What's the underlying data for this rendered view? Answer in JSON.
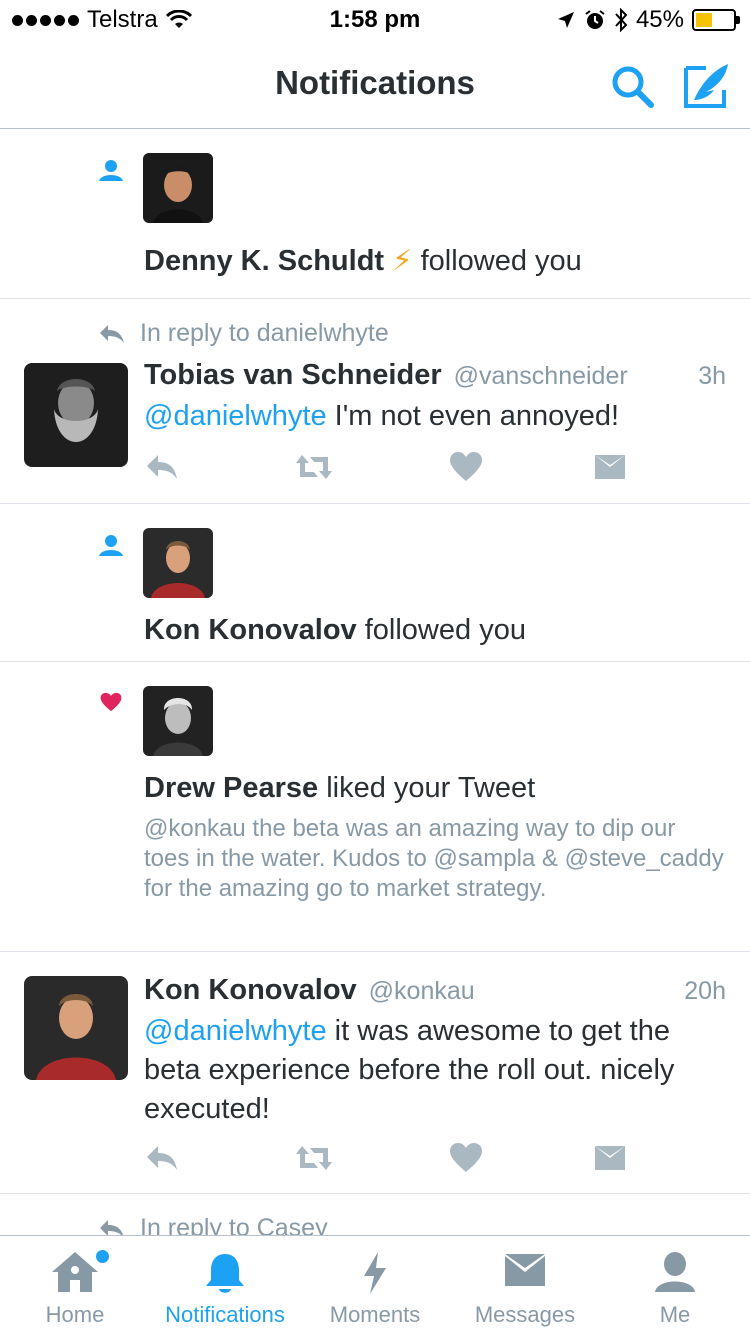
{
  "status_bar": {
    "carrier": "Telstra",
    "time": "1:58 pm",
    "battery_percent": "45%",
    "battery_level": 0.45,
    "signal_bars": 5
  },
  "header": {
    "title": "Notifications",
    "search_icon": "search-icon",
    "compose_icon": "compose-tweet-icon"
  },
  "notifications": [
    {
      "type": "follow",
      "name": "Denny K. Schuldt",
      "name_emoji": "⚡",
      "action": "followed you"
    },
    {
      "type": "reply",
      "reply_context": "In reply to danielwhyte",
      "name": "Tobias van Schneider",
      "handle": "@vanschneider",
      "age": "3h",
      "mention": "@danielwhyte",
      "text": " I'm not even annoyed!"
    },
    {
      "type": "follow",
      "name": "Kon Konovalov",
      "action": "followed you"
    },
    {
      "type": "like",
      "name": "Drew Pearse",
      "action": "liked your Tweet",
      "quoted": "@konkau the beta was an amazing way to dip our toes in the water. Kudos to @sampla & @steve_caddy for the amazing go to market strategy."
    },
    {
      "type": "mention",
      "name": "Kon Konovalov",
      "handle": "@konkau",
      "age": "20h",
      "mention": "@danielwhyte",
      "text": " it was awesome to get the beta experience before the roll out. nicely executed!"
    },
    {
      "type": "reply",
      "reply_context": "In reply to Casey"
    }
  ],
  "tabs": [
    {
      "label": "Home",
      "icon": "home-icon",
      "has_badge": true
    },
    {
      "label": "Notifications",
      "icon": "bell-icon",
      "active": true
    },
    {
      "label": "Moments",
      "icon": "lightning-icon"
    },
    {
      "label": "Messages",
      "icon": "envelope-icon"
    },
    {
      "label": "Me",
      "icon": "person-icon"
    }
  ],
  "colors": {
    "accent": "#1da1f2",
    "text": "#292f33",
    "muted": "#8899a6",
    "like": "#e0245e",
    "divider": "#dde3e8"
  }
}
